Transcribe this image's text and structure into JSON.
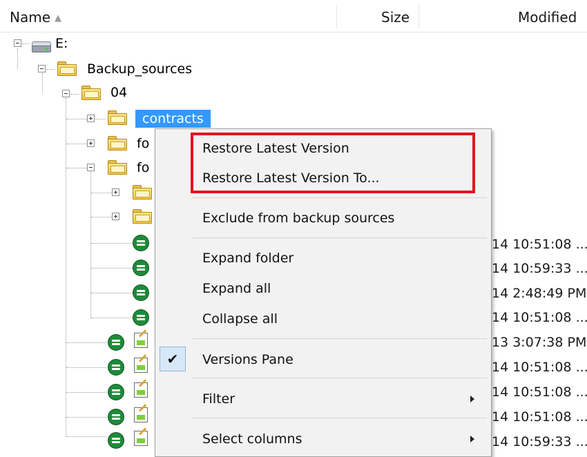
{
  "columns": {
    "name": "Name",
    "name_sort_glyph": "▲",
    "size": "Size",
    "modified": "Modified"
  },
  "tree": {
    "drive_label": "E:",
    "backup_sources": "Backup_sources",
    "folder_04": "04",
    "contracts": "contracts",
    "folder_fo1": "fo",
    "folder_fo2": "fo"
  },
  "modified_values": [
    "14 10:51:08 ...",
    "14 10:59:33 ...",
    "14 2:48:49 PM",
    "14 10:51:08 ...",
    "13 3:07:38 PM",
    "14 10:51:08 ...",
    "14 10:51:08 ...",
    "14 10:51:08 ...",
    "14 10:59:33 ..."
  ],
  "context_menu": {
    "restore_latest": "Restore Latest Version",
    "restore_latest_to": "Restore Latest Version To...",
    "exclude": "Exclude from backup sources",
    "expand_folder": "Expand folder",
    "expand_all": "Expand all",
    "collapse_all": "Collapse all",
    "versions_pane": "Versions Pane",
    "versions_pane_checked": true,
    "check_glyph": "✔",
    "filter": "Filter",
    "select_columns": "Select columns"
  },
  "colors": {
    "selection": "#3399ff",
    "highlight": "#e8121f",
    "status_green": "#1f8a3a"
  },
  "icons": [
    "drive-icon",
    "folder-icon",
    "status-ok-icon",
    "document-edit-icon",
    "check-icon",
    "submenu-arrow-icon"
  ]
}
